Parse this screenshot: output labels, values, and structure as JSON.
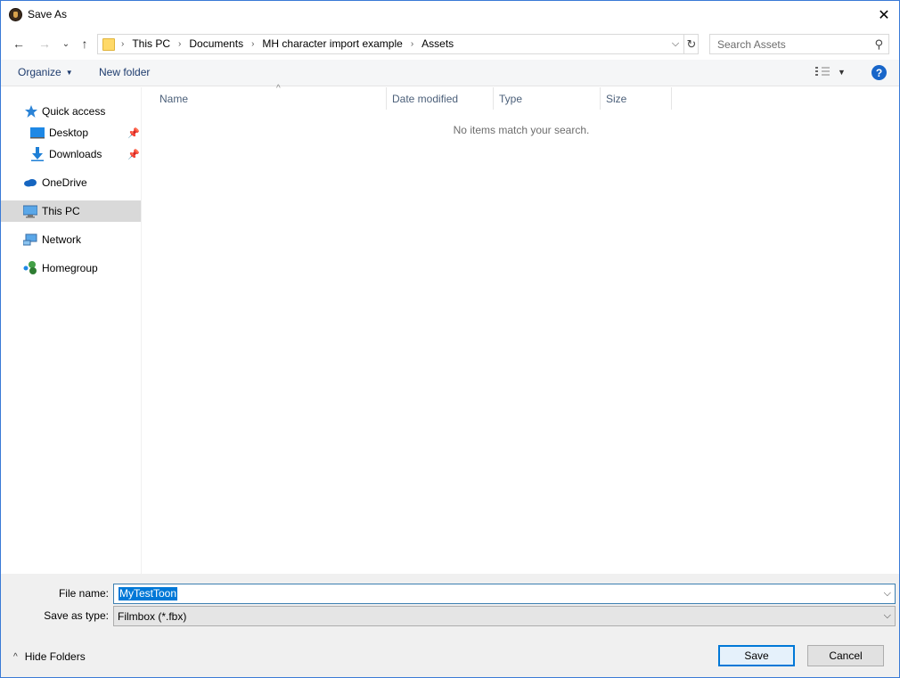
{
  "window": {
    "title": "Save As"
  },
  "nav": {
    "breadcrumbs": [
      "This PC",
      "Documents",
      "MH character import example",
      "Assets"
    ],
    "search_placeholder": "Search Assets"
  },
  "toolbar": {
    "organize_label": "Organize",
    "new_folder_label": "New folder",
    "help_glyph": "?"
  },
  "navpane": {
    "items": [
      {
        "label": "Quick access",
        "icon": "star-icon"
      },
      {
        "label": "Desktop",
        "icon": "desktop-icon",
        "pinned": true
      },
      {
        "label": "Downloads",
        "icon": "download-icon",
        "pinned": true
      },
      {
        "label": "OneDrive",
        "icon": "cloud-icon"
      },
      {
        "label": "This PC",
        "icon": "computer-icon",
        "selected": true
      },
      {
        "label": "Network",
        "icon": "network-icon"
      },
      {
        "label": "Homegroup",
        "icon": "homegroup-icon"
      }
    ]
  },
  "filelist": {
    "columns": [
      "Name",
      "Date modified",
      "Type",
      "Size"
    ],
    "empty_message": "No items match your search."
  },
  "form": {
    "file_name_label": "File name:",
    "file_name_value": "MyTestToon",
    "save_type_label": "Save as type:",
    "save_type_value": "Filmbox (*.fbx)",
    "hide_folders_label": "Hide Folders",
    "save_label": "Save",
    "cancel_label": "Cancel"
  },
  "colors": {
    "accent": "#0078d7",
    "window_border": "#3a7ad6",
    "toolbar_text": "#1e3c6e",
    "selected_bg": "#d9d9d9"
  }
}
